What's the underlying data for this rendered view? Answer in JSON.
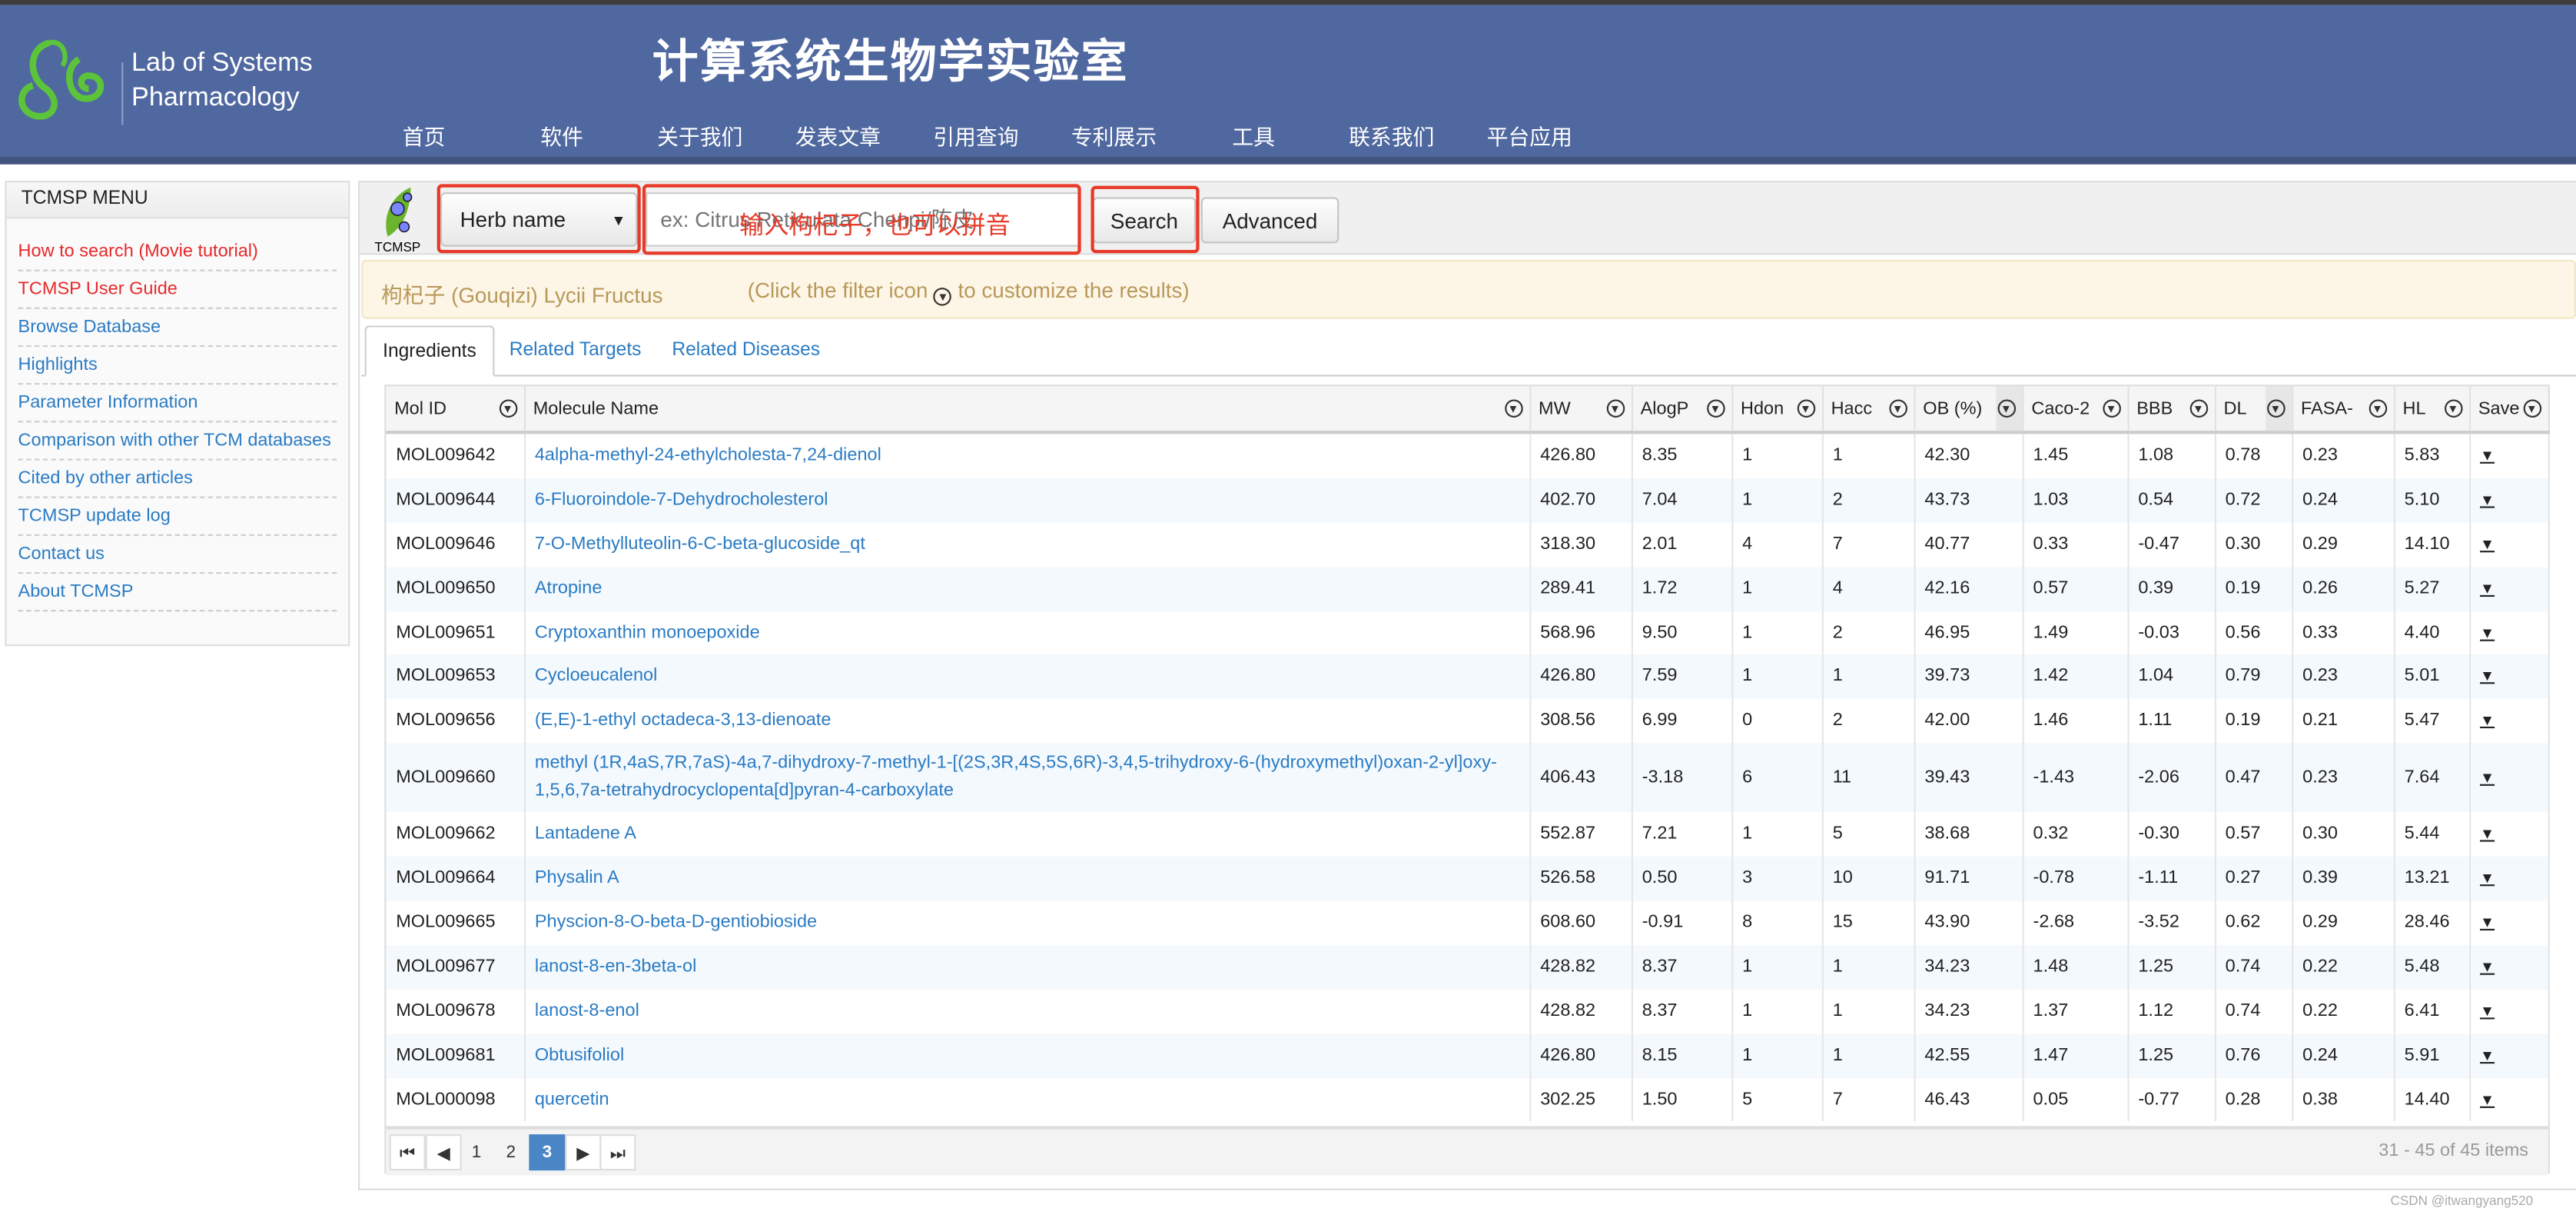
{
  "header": {
    "lab_name_line1": "Lab of Systems",
    "lab_name_line2": "Pharmacology",
    "title": "计算系统生物学实验室",
    "nav": [
      "首页",
      "软件",
      "关于我们",
      "发表文章",
      "引用查询",
      "专利展示",
      "工具",
      "联系我们",
      "平台应用"
    ],
    "header_color": "#5068a0"
  },
  "sidebar": {
    "title": "TCMSP MENU",
    "items": [
      {
        "label": "How to search (Movie tutorial)",
        "color": "red"
      },
      {
        "label": "TCMSP User Guide",
        "color": "red"
      },
      {
        "label": "Browse Database"
      },
      {
        "label": "Highlights"
      },
      {
        "label": "Parameter Information"
      },
      {
        "label": "Comparison with other TCM databases"
      },
      {
        "label": "Cited by other articles"
      },
      {
        "label": "TCMSP update log"
      },
      {
        "label": "Contact us"
      },
      {
        "label": "About TCMSP"
      }
    ]
  },
  "search": {
    "logo_text": "TCMSP",
    "select_value": "Herb name",
    "placeholder": "ex: Citrus Reticulata Chenpi/陈皮",
    "search_label": "Search",
    "advanced_label": "Advanced",
    "annotation": "输入枸杞子，也可以拼音"
  },
  "notice": {
    "herb": "枸杞子 (Gouqizi) Lycii Fructus",
    "hint_before": "(Click the filter icon",
    "hint_after": "to customize the results)"
  },
  "tabs": [
    {
      "label": "Ingredients",
      "active": true
    },
    {
      "label": "Related Targets"
    },
    {
      "label": "Related Diseases"
    }
  ],
  "table": {
    "columns": [
      "Mol ID",
      "Molecule Name",
      "MW",
      "AlogP",
      "Hdon",
      "Hacc",
      "OB (%)",
      "Caco-2",
      "BBB",
      "DL",
      "FASA-",
      "HL",
      "Save"
    ],
    "save_icon": "▼",
    "rows": [
      [
        "MOL009642",
        "4alpha-methyl-24-ethylcholesta-7,24-dienol",
        "426.80",
        "8.35",
        "1",
        "1",
        "42.30",
        "1.45",
        "1.08",
        "0.78",
        "0.23",
        "5.83"
      ],
      [
        "MOL009644",
        "6-Fluoroindole-7-Dehydrocholesterol",
        "402.70",
        "7.04",
        "1",
        "2",
        "43.73",
        "1.03",
        "0.54",
        "0.72",
        "0.24",
        "5.10"
      ],
      [
        "MOL009646",
        "7-O-Methylluteolin-6-C-beta-glucoside_qt",
        "318.30",
        "2.01",
        "4",
        "7",
        "40.77",
        "0.33",
        "-0.47",
        "0.30",
        "0.29",
        "14.10"
      ],
      [
        "MOL009650",
        "Atropine",
        "289.41",
        "1.72",
        "1",
        "4",
        "42.16",
        "0.57",
        "0.39",
        "0.19",
        "0.26",
        "5.27"
      ],
      [
        "MOL009651",
        "Cryptoxanthin monoepoxide",
        "568.96",
        "9.50",
        "1",
        "2",
        "46.95",
        "1.49",
        "-0.03",
        "0.56",
        "0.33",
        "4.40"
      ],
      [
        "MOL009653",
        "Cycloeucalenol",
        "426.80",
        "7.59",
        "1",
        "1",
        "39.73",
        "1.42",
        "1.04",
        "0.79",
        "0.23",
        "5.01"
      ],
      [
        "MOL009656",
        "(E,E)-1-ethyl octadeca-3,13-dienoate",
        "308.56",
        "6.99",
        "0",
        "2",
        "42.00",
        "1.46",
        "1.11",
        "0.19",
        "0.21",
        "5.47"
      ],
      [
        "MOL009660",
        "methyl (1R,4aS,7R,7aS)-4a,7-dihydroxy-7-methyl-1-[(2S,3R,4S,5S,6R)-3,4,5-trihydroxy-6-(hydroxymethyl)oxan-2-yl]oxy-1,5,6,7a-tetrahydrocyclopenta[d]pyran-4-carboxylate",
        "406.43",
        "-3.18",
        "6",
        "11",
        "39.43",
        "-1.43",
        "-2.06",
        "0.47",
        "0.23",
        "7.64"
      ],
      [
        "MOL009662",
        "Lantadene A",
        "552.87",
        "7.21",
        "1",
        "5",
        "38.68",
        "0.32",
        "-0.30",
        "0.57",
        "0.30",
        "5.44"
      ],
      [
        "MOL009664",
        "Physalin A",
        "526.58",
        "0.50",
        "3",
        "10",
        "91.71",
        "-0.78",
        "-1.11",
        "0.27",
        "0.39",
        "13.21"
      ],
      [
        "MOL009665",
        "Physcion-8-O-beta-D-gentiobioside",
        "608.60",
        "-0.91",
        "8",
        "15",
        "43.90",
        "-2.68",
        "-3.52",
        "0.62",
        "0.29",
        "28.46"
      ],
      [
        "MOL009677",
        "lanost-8-en-3beta-ol",
        "428.82",
        "8.37",
        "1",
        "1",
        "34.23",
        "1.48",
        "1.25",
        "0.74",
        "0.22",
        "5.48"
      ],
      [
        "MOL009678",
        "lanost-8-enol",
        "428.82",
        "8.37",
        "1",
        "1",
        "34.23",
        "1.37",
        "1.12",
        "0.74",
        "0.22",
        "6.41"
      ],
      [
        "MOL009681",
        "Obtusifoliol",
        "426.80",
        "8.15",
        "1",
        "1",
        "42.55",
        "1.47",
        "1.25",
        "0.76",
        "0.24",
        "5.91"
      ],
      [
        "MOL000098",
        "quercetin",
        "302.25",
        "1.50",
        "5",
        "7",
        "46.43",
        "0.05",
        "-0.77",
        "0.28",
        "0.38",
        "14.40"
      ]
    ]
  },
  "pager": {
    "first": "⏮",
    "prev": "◀",
    "pages": [
      "1",
      "2",
      "3"
    ],
    "current": "3",
    "next": "▶",
    "last": "⏭",
    "summary": "31 - 45 of 45 items"
  },
  "watermark": "CSDN @itwangyang520"
}
